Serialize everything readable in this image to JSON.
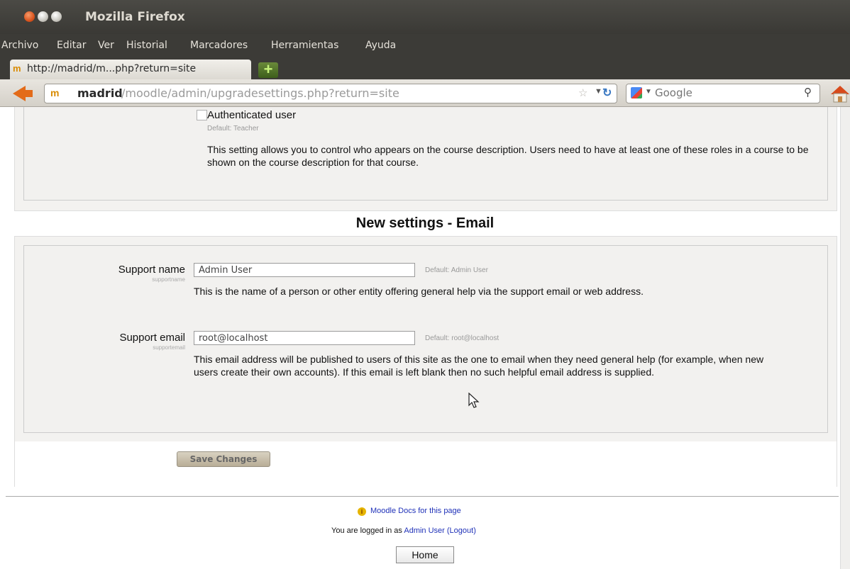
{
  "window": {
    "app_title": "Mozilla Firefox"
  },
  "menu": [
    "Archivo",
    "Editar",
    "Ver",
    "Historial",
    "Marcadores",
    "Herramientas",
    "Ayuda"
  ],
  "tab": {
    "favicon": "m",
    "title": "http://madrid/m...php?return=site",
    "new_tab_label": "+"
  },
  "navbar": {
    "url_favicon": "m",
    "url_host": "madrid",
    "url_path": "/moodle/admin/upgradesettings.php?return=site",
    "search_placeholder": "Google"
  },
  "course_contact": {
    "checkbox_label": "Authenticated user",
    "default_text": "Default: Teacher",
    "description": "This setting allows you to control who appears on the course description. Users need to have at least one of these roles in a course to be shown on the course description for that course."
  },
  "section_heading": "New settings - Email",
  "support_name": {
    "label": "Support name",
    "sublabel": "supportname",
    "value": "Admin User",
    "default_text": "Default: Admin User",
    "description": "This is the name of a person or other entity offering general help via the support email or web address."
  },
  "support_email": {
    "label": "Support email",
    "sublabel": "supportemail",
    "value": "root@localhost",
    "default_text": "Default: root@localhost",
    "description": "This email address will be published to users of this site as the one to email when they need general help (for example, when new users create their own accounts). If this email is left blank then no such helpful email address is supplied."
  },
  "actions": {
    "save_label": "Save Changes"
  },
  "footer": {
    "docs_link": "Moodle Docs for this page",
    "logged_prefix": "You are logged in as",
    "logged_user": "Admin User",
    "logout_link": "(Logout)",
    "home_label": "Home"
  },
  "colors": {
    "link": "#1f31b8",
    "titlebar": "#3c3b37",
    "close_button": "#d9541e"
  }
}
